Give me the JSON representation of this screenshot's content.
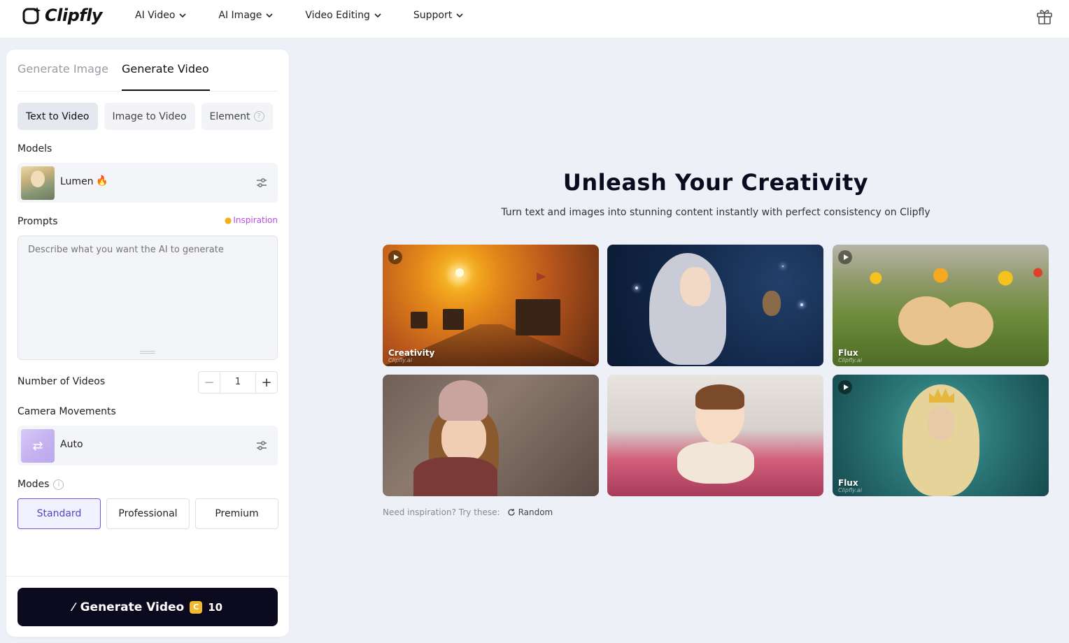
{
  "brand": {
    "name": "Clipfly"
  },
  "nav": [
    {
      "label": "AI Video"
    },
    {
      "label": "AI Image"
    },
    {
      "label": "Video Editing"
    },
    {
      "label": "Support"
    }
  ],
  "panel": {
    "tabs": {
      "inactive": "Generate Image",
      "active": "Generate Video"
    },
    "mode_tabs": [
      "Text to Video",
      "Image to Video",
      "Element"
    ],
    "models_label": "Models",
    "model_name": "Lumen",
    "prompts_label": "Prompts",
    "inspiration": "Inspiration",
    "prompt_placeholder": "Describe what you want the AI to generate",
    "num_videos_label": "Number of Videos",
    "num_videos_value": "1",
    "camera_label": "Camera Movements",
    "camera_value": "Auto",
    "modes_label": "Modes",
    "modes": [
      "Standard",
      "Professional",
      "Premium"
    ],
    "selected_mode": "Standard",
    "generate_label": "Generate Video",
    "generate_cost": "10"
  },
  "hero": {
    "title": "Unleash Your Creativity",
    "subtitle": "Turn text and images into stunning content instantly with perfect consistency on Clipfly"
  },
  "gallery": [
    {
      "label": "Creativity",
      "watermark": "Clipfly.ai",
      "video": true
    },
    {
      "label": "",
      "watermark": "",
      "video": false
    },
    {
      "label": "Flux",
      "watermark": "Clipfly.ai",
      "video": true
    },
    {
      "label": "",
      "watermark": "",
      "video": false
    },
    {
      "label": "",
      "watermark": "",
      "video": false
    },
    {
      "label": "Flux",
      "watermark": "Clipfly.ai",
      "video": true
    }
  ],
  "inspire": {
    "prompt": "Need inspiration? Try these:",
    "random": "Random"
  },
  "colors": {
    "accent": "#6a5ae0",
    "button_dark": "#0c0a1e",
    "inspiration": "#b84ee6",
    "coin": "#f2b82e"
  },
  "icons": [
    "logo-icon",
    "chevron-down-icon",
    "gift-icon",
    "help-icon",
    "fire-icon",
    "sliders-icon",
    "bulb-icon",
    "minus-icon",
    "plus-icon",
    "shuffle-icon",
    "info-icon",
    "magic-wand-icon",
    "coin-icon",
    "play-icon",
    "refresh-icon"
  ]
}
